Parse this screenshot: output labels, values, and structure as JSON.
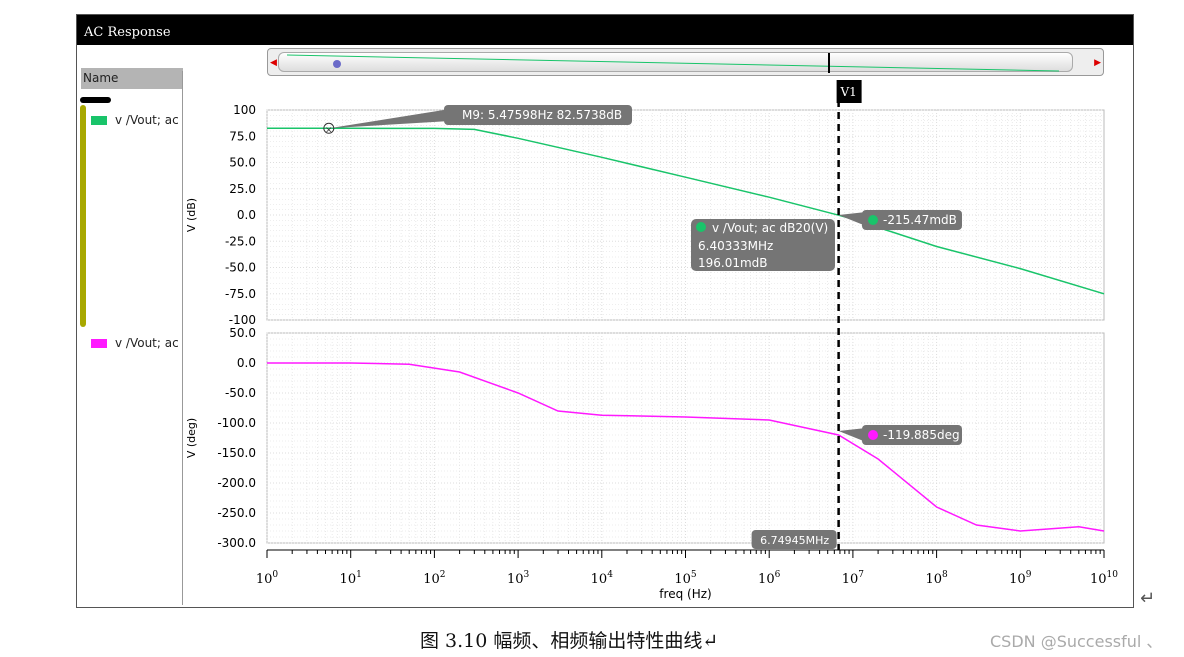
{
  "window": {
    "title": "AC Response"
  },
  "sidebar": {
    "header": "Name",
    "traces": [
      {
        "label": "v /Vout; ac",
        "color": "#19c46a"
      },
      {
        "label": "v /Vout; ac",
        "color": "#ff19ff"
      }
    ]
  },
  "cursor": {
    "label": "V1",
    "freq_hz": 6749450,
    "readout": "6.74945MHz"
  },
  "markers": {
    "m9": {
      "label": "M9: 5.47598Hz 82.5738dB",
      "freq_hz": 5.47598,
      "value": 82.5738
    },
    "mag_cursor": {
      "label": "-215.47mdB"
    },
    "phase_cursor": {
      "label": "-119.885deg"
    },
    "crosshair": {
      "line1": "v /Vout; ac dB20(V)",
      "line2": "6.40333MHz",
      "line3": "196.01mdB"
    }
  },
  "caption": "图 3.10 幅频、相频输出特性曲线↵",
  "watermark": "CSDN @Successful 、",
  "return_mark": "↵",
  "chart_data": [
    {
      "type": "line",
      "xlabel": "freq (Hz)",
      "ylabel": "V (dB)",
      "xscale": "log",
      "xlim": [
        1,
        10000000000
      ],
      "ylim": [
        -100,
        100
      ],
      "yticks": [
        "100",
        "75.0",
        "50.0",
        "25.0",
        "0.0",
        "-25.0",
        "-50.0",
        "-75.0",
        "-100"
      ],
      "series": [
        {
          "name": "v /Vout; ac",
          "color": "#19c46a",
          "x": [
            1,
            10,
            100,
            300,
            1000,
            10000,
            100000,
            1000000,
            6749450,
            10000000,
            100000000,
            1000000000,
            10000000000
          ],
          "y": [
            82.6,
            82.6,
            82.5,
            81.5,
            73,
            55,
            36,
            17,
            -0.2,
            -4,
            -30,
            -51,
            -75
          ]
        }
      ]
    },
    {
      "type": "line",
      "xlabel": "freq (Hz)",
      "ylabel": "V (deg)",
      "xscale": "log",
      "xlim": [
        1,
        10000000000
      ],
      "ylim": [
        -300,
        50
      ],
      "yticks": [
        "50.0",
        "0.0",
        "-50.0",
        "-100.0",
        "-150.0",
        "-200.0",
        "-250.0",
        "-300.0"
      ],
      "xtick_exponents": [
        0,
        1,
        2,
        3,
        4,
        5,
        6,
        7,
        8,
        9,
        10
      ],
      "series": [
        {
          "name": "v /Vout; ac",
          "color": "#ff19ff",
          "x": [
            1,
            10,
            50,
            200,
            1000,
            3000,
            10000,
            100000,
            1000000,
            6749450,
            20000000,
            100000000,
            300000000,
            1000000000,
            5000000000,
            10000000000
          ],
          "y": [
            0,
            0,
            -2,
            -15,
            -50,
            -80,
            -87,
            -90,
            -95,
            -120,
            -160,
            -240,
            -270,
            -280,
            -273,
            -280
          ]
        }
      ]
    }
  ]
}
